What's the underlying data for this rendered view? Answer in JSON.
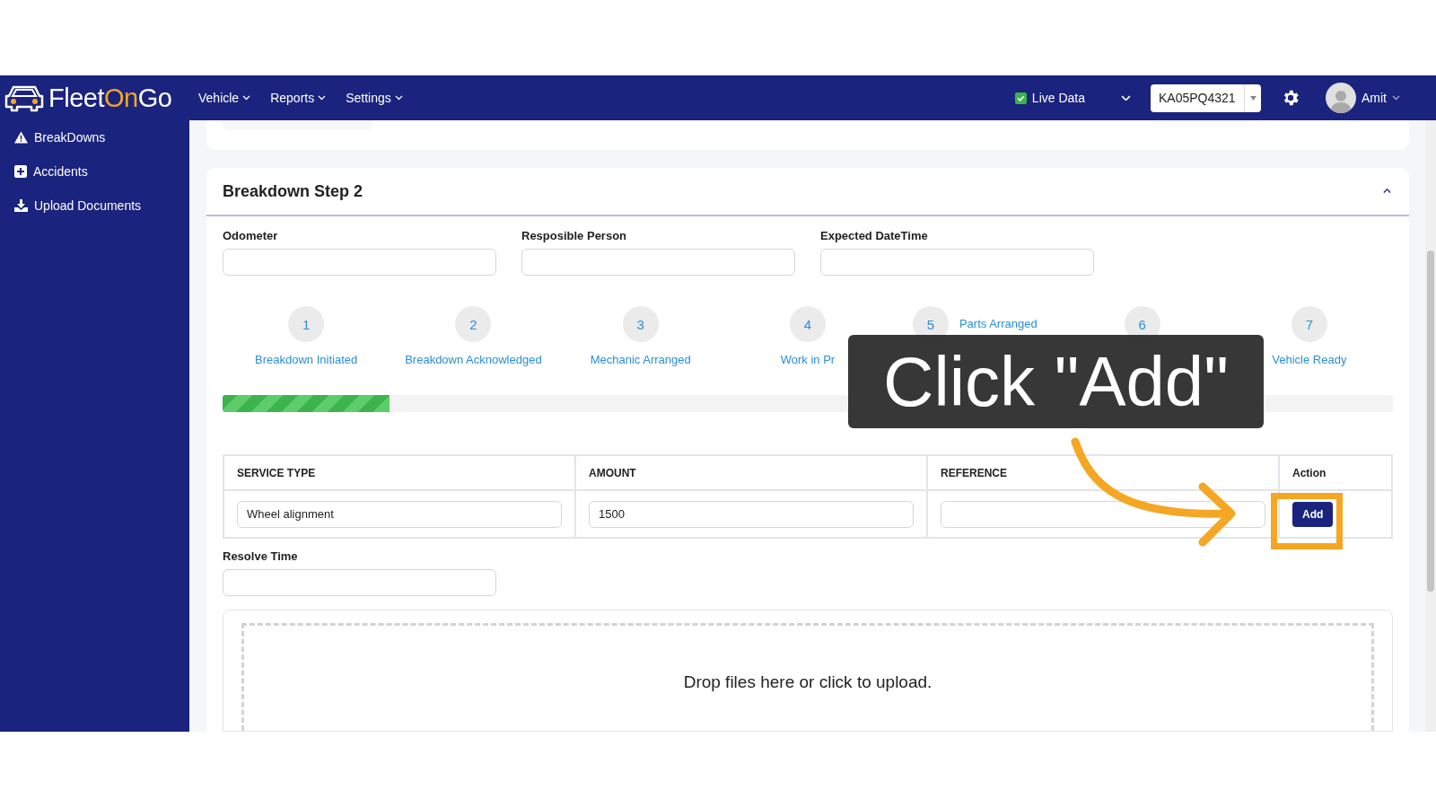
{
  "navbar": {
    "logo": [
      {
        "text": "Fleet",
        "accent": false
      },
      {
        "text": "On",
        "accent": true
      },
      {
        "text": "Go",
        "accent": false
      }
    ],
    "menus": [
      {
        "label": "Vehicle"
      },
      {
        "label": "Reports"
      },
      {
        "label": "Settings"
      }
    ],
    "live_data": {
      "label": "Live Data",
      "checked": true
    },
    "vehicle_select": {
      "value": "KA05PQ4321"
    },
    "user": {
      "name": "Amit"
    }
  },
  "sidebar": {
    "items": [
      {
        "label": "BreakDowns"
      },
      {
        "label": "Accidents"
      },
      {
        "label": "Upload Documents"
      }
    ]
  },
  "card": {
    "title": "Breakdown Step 2",
    "expanded": true,
    "fields": [
      {
        "label": "Odometer"
      },
      {
        "label": "Resposible Person"
      },
      {
        "label": "Expected DateTime"
      }
    ],
    "steps": [
      {
        "number": "1",
        "label": "Breakdown Initiated",
        "inline": false
      },
      {
        "number": "2",
        "label": "Breakdown Acknowledged",
        "inline": false
      },
      {
        "number": "3",
        "label": "Mechanic Arranged",
        "inline": false
      },
      {
        "number": "4",
        "label": "Work in Pr",
        "inline": false
      },
      {
        "number": "5",
        "label": "Parts Arranged",
        "inline": true
      },
      {
        "number": "6",
        "inline": false
      },
      {
        "number": "7",
        "label": "Vehicle Ready",
        "inline": false
      }
    ],
    "progress": {
      "level": 0.143
    },
    "table": {
      "columns": [
        "SERVICE TYPE",
        "AMOUNT",
        "REFERENCE",
        "Action"
      ],
      "rows": [
        {
          "service_type": "Wheel alignment",
          "amount": "1500",
          "button": "Add"
        }
      ]
    },
    "resolve_time": {
      "label": "Resolve Time"
    },
    "dropzone": {
      "text": "Drop files here or click to upload."
    }
  },
  "tutorial": {
    "caption": "Click \"Add\""
  }
}
